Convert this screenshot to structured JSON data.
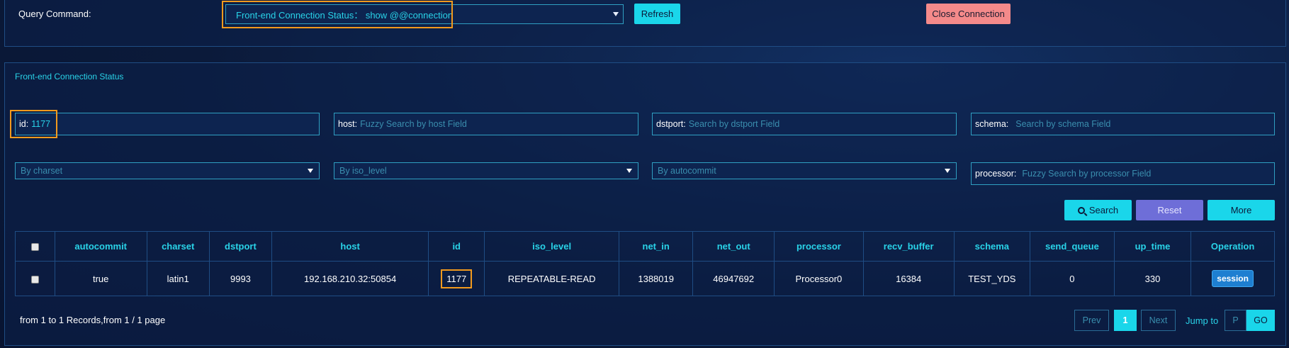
{
  "query": {
    "label": "Query Command:",
    "selected": "Front-end Connection Status： show @@connection",
    "refresh_label": "Refresh",
    "close_label": "Close Connection"
  },
  "panel": {
    "title": "Front-end Connection Status"
  },
  "filters": {
    "id": {
      "label": "id:",
      "value": "1177"
    },
    "host": {
      "label": "host:",
      "placeholder": "Fuzzy Search by host Field"
    },
    "dstport": {
      "label": "dstport:",
      "placeholder": "Search by dstport Field"
    },
    "schema": {
      "label": "schema:",
      "placeholder": "Search by schema Field"
    },
    "charset": {
      "placeholder": "By charset"
    },
    "iso_level": {
      "placeholder": "By iso_level"
    },
    "autocommit": {
      "placeholder": "By autocommit"
    },
    "processor": {
      "label": "processor:",
      "placeholder": "Fuzzy Search by processor Field"
    }
  },
  "actions": {
    "search_label": "Search",
    "reset_label": "Reset",
    "more_label": "More"
  },
  "table": {
    "columns": [
      "autocommit",
      "charset",
      "dstport",
      "host",
      "id",
      "iso_level",
      "net_in",
      "net_out",
      "processor",
      "recv_buffer",
      "schema",
      "send_queue",
      "up_time",
      "Operation"
    ],
    "rows": [
      {
        "autocommit": "true",
        "charset": "latin1",
        "dstport": "9993",
        "host": "192.168.210.32:50854",
        "id": "1177",
        "iso_level": "REPEATABLE-READ",
        "net_in": "1388019",
        "net_out": "46947692",
        "processor": "Processor0",
        "recv_buffer": "16384",
        "schema": "TEST_YDS",
        "send_queue": "0",
        "up_time": "330",
        "operation": "session"
      }
    ]
  },
  "pagination": {
    "summary": "from 1 to 1 Records,from 1 / 1 page",
    "prev": "Prev",
    "current": "1",
    "next": "Next",
    "jump_label": "Jump to",
    "jump_placeholder": "P",
    "go": "GO"
  },
  "colors": {
    "accent": "#1ad6ea",
    "highlight": "#f29a1d",
    "danger": "#f48a8a",
    "reset": "#6e6ed8",
    "background": "#0b1a3a"
  }
}
